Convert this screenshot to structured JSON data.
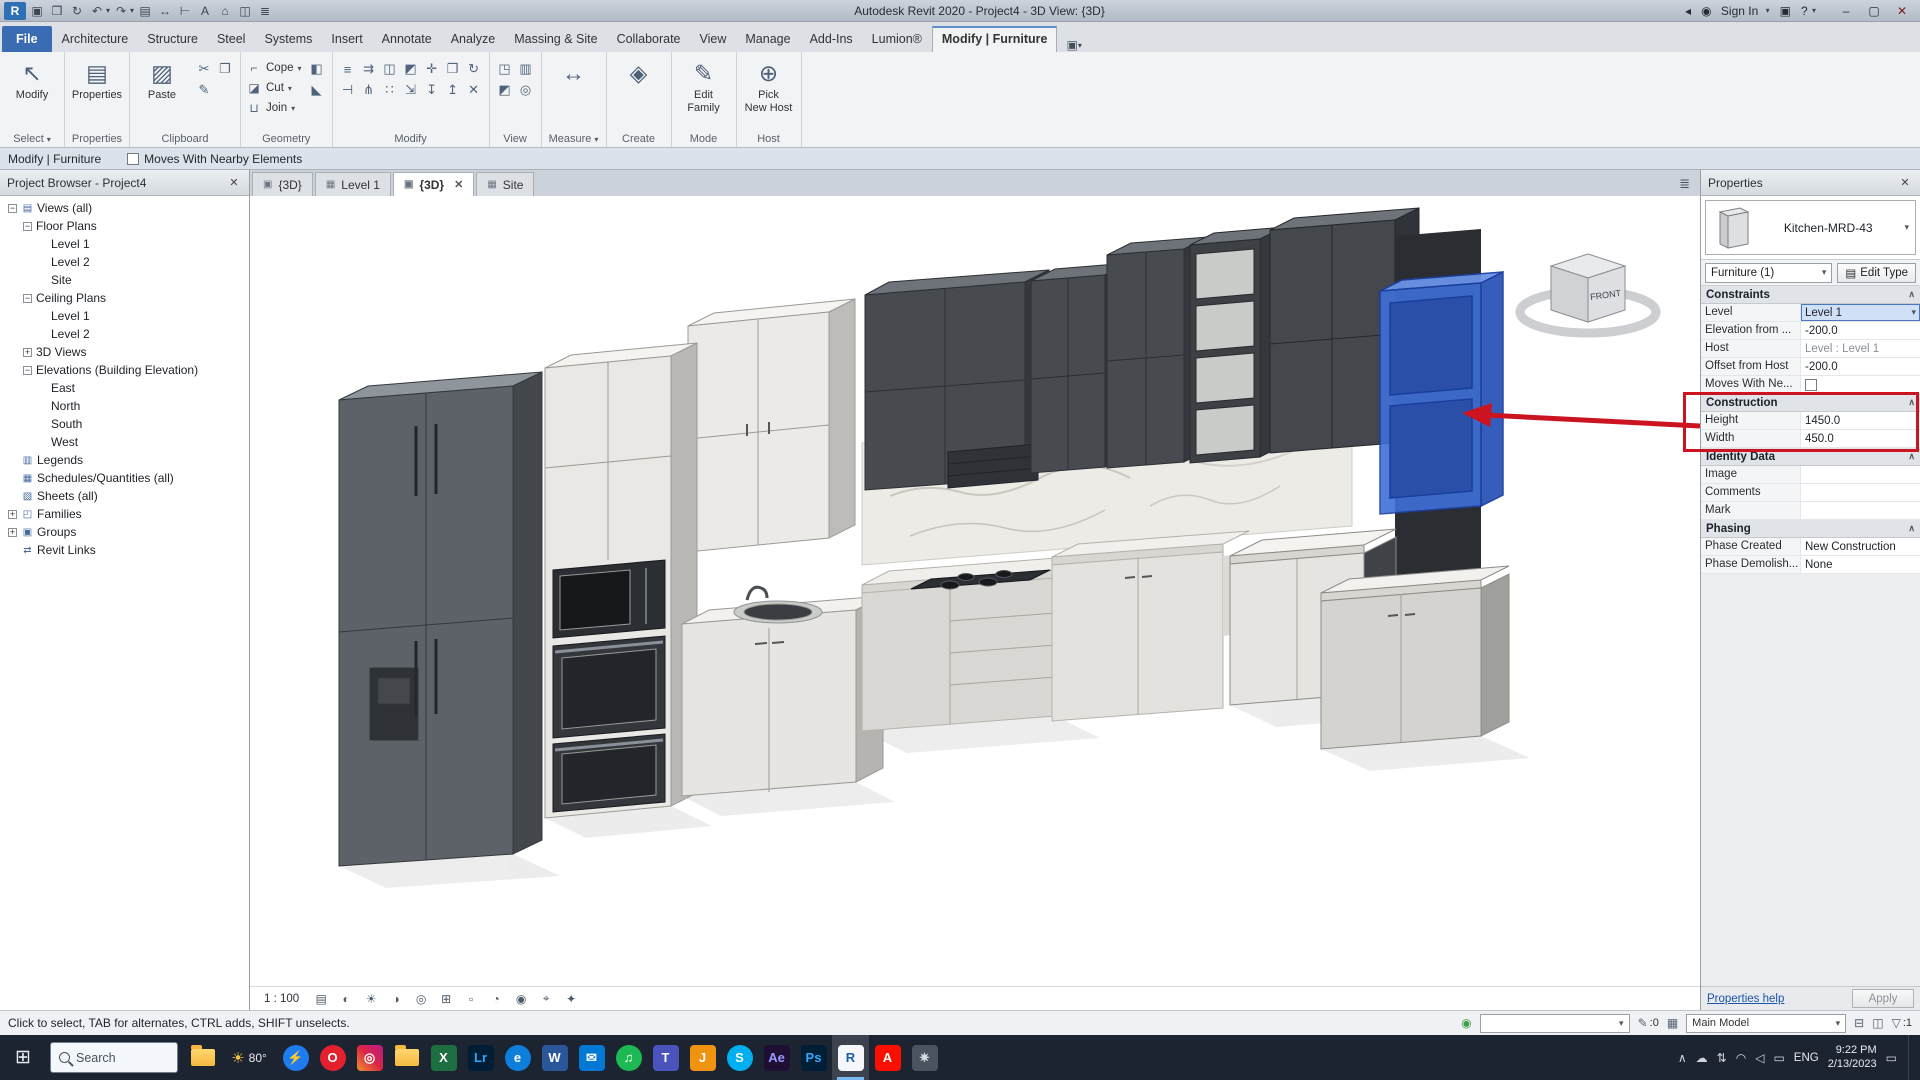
{
  "colors": {
    "accent_blue": "#2f6fb3",
    "selection_blue": "#3f6fd8",
    "annotation_red": "#cc1420",
    "taskbar_bg": "#1c2431"
  },
  "title_bar": {
    "app_title": "Autodesk Revit 2020 - Project4 - 3D View: {3D}",
    "sign_in_label": "Sign In",
    "qat_icons": [
      "app-menu",
      "save",
      "open",
      "sync",
      "undo",
      "redo",
      "print",
      "measure-qat",
      "dimension",
      "text",
      "default-3d",
      "section",
      "thin-lines"
    ],
    "right_icons": [
      "back",
      "user",
      "cart",
      "help"
    ],
    "window_controls": [
      "minimize",
      "maximize",
      "close"
    ]
  },
  "ribbon": {
    "tabs": [
      "File",
      "Architecture",
      "Structure",
      "Steel",
      "Systems",
      "Insert",
      "Annotate",
      "Analyze",
      "Massing & Site",
      "Collaborate",
      "View",
      "Manage",
      "Add-Ins",
      "Lumion®",
      "Modify | Furniture"
    ],
    "active_tab": "Modify | Furniture",
    "panels": [
      {
        "label": "Select",
        "caret": true,
        "big": [
          {
            "icon": "modify-arrow",
            "label": "Modify"
          }
        ]
      },
      {
        "label": "Properties",
        "big": [
          {
            "icon": "properties-big",
            "label": "Properties"
          }
        ]
      },
      {
        "label": "Clipboard",
        "big": [
          {
            "icon": "paste",
            "label": "Paste"
          }
        ],
        "small": [
          "cut-small",
          "copy-small",
          "match"
        ],
        "small_cols": 2
      },
      {
        "label": "Geometry",
        "rows": [
          {
            "icon": "cope",
            "label": "Cope",
            "caret": true
          },
          {
            "icon": "cut-geo",
            "label": "Cut",
            "caret": true
          },
          {
            "icon": "join",
            "label": "Join",
            "caret": true
          }
        ],
        "small": [
          "paint",
          "split-face"
        ],
        "small_cols": 1
      },
      {
        "label": "Modify",
        "small": [
          "align",
          "offset",
          "mirror-axis",
          "mirror-draw",
          "move",
          "copy",
          "rotate",
          "trim",
          "split",
          "array",
          "scale",
          "pin",
          "unpin",
          "delete"
        ],
        "small_cols": 7
      },
      {
        "label": "View",
        "small": [
          "wireframe",
          "hidden-line",
          "shaded",
          "render-view"
        ],
        "small_cols": 2
      },
      {
        "label": "Measure",
        "caret": true,
        "big": [
          {
            "icon": "measure-big",
            "label": ""
          }
        ]
      },
      {
        "label": "Create",
        "big": [
          {
            "icon": "create-big",
            "label": ""
          }
        ]
      },
      {
        "label": "Mode",
        "big": [
          {
            "icon": "edit-family",
            "label": "Edit\nFamily"
          }
        ]
      },
      {
        "label": "Host",
        "big": [
          {
            "icon": "pick-host",
            "label": "Pick\nNew Host"
          }
        ]
      }
    ]
  },
  "options_bar": {
    "mode_label": "Modify | Furniture",
    "checkbox_label": "Moves With Nearby Elements",
    "checkbox_checked": false
  },
  "project_browser": {
    "title": "Project Browser - Project4",
    "tree": [
      {
        "label": "Views (all)",
        "depth": 0,
        "expander": "-",
        "icon": "views"
      },
      {
        "label": "Floor Plans",
        "depth": 1,
        "expander": "-"
      },
      {
        "label": "Level 1",
        "depth": 2
      },
      {
        "label": "Level 2",
        "depth": 2
      },
      {
        "label": "Site",
        "depth": 2
      },
      {
        "label": "Ceiling Plans",
        "depth": 1,
        "expander": "-"
      },
      {
        "label": "Level 1",
        "depth": 2
      },
      {
        "label": "Level 2",
        "depth": 2
      },
      {
        "label": "3D Views",
        "depth": 1,
        "expander": "+"
      },
      {
        "label": "Elevations (Building Elevation)",
        "depth": 1,
        "expander": "-"
      },
      {
        "label": "East",
        "depth": 2
      },
      {
        "label": "North",
        "depth": 2
      },
      {
        "label": "South",
        "depth": 2
      },
      {
        "label": "West",
        "depth": 2
      },
      {
        "label": "Legends",
        "depth": 0,
        "icon": "legend"
      },
      {
        "label": "Schedules/Quantities (all)",
        "depth": 0,
        "icon": "schedule"
      },
      {
        "label": "Sheets (all)",
        "depth": 0,
        "icon": "sheet"
      },
      {
        "label": "Families",
        "depth": 0,
        "expander": "+",
        "icon": "family"
      },
      {
        "label": "Groups",
        "depth": 0,
        "expander": "+",
        "icon": "group"
      },
      {
        "label": "Revit Links",
        "depth": 0,
        "icon": "link"
      }
    ]
  },
  "view_tabs": [
    {
      "label": "{3D}",
      "icon": "tab-cube"
    },
    {
      "label": "Level 1",
      "icon": "tab-plan"
    },
    {
      "label": "{3D}",
      "icon": "tab-cube",
      "active": true,
      "closable": true
    },
    {
      "label": "Site",
      "icon": "tab-plan"
    }
  ],
  "canvas": {
    "viewcube_front_label": "FRONT"
  },
  "view_controls": {
    "scale": "1 : 100",
    "icons": [
      "detail-level",
      "visual-style",
      "sun",
      "shadows",
      "render-dialog",
      "crop",
      "show-crop",
      "hide-isolate",
      "reveal",
      "locked",
      "tvp"
    ]
  },
  "properties": {
    "header": "Properties",
    "type_name": "Kitchen-MRD-43",
    "category_selector": "Furniture (1)",
    "edit_type_label": "Edit Type",
    "rows": [
      {
        "kind": "section",
        "label": "Constraints"
      },
      {
        "kind": "row",
        "label": "Level",
        "value": "Level 1",
        "selected": true,
        "caret": true
      },
      {
        "kind": "row",
        "label": "Elevation from ...",
        "value": "-200.0"
      },
      {
        "kind": "row",
        "label": "Host",
        "value": "Level : Level 1",
        "disabled": true
      },
      {
        "kind": "row",
        "label": "Offset from Host",
        "value": "-200.0"
      },
      {
        "kind": "row",
        "label": "Moves With Ne...",
        "value": "",
        "checkbox": true
      },
      {
        "kind": "section",
        "label": "Construction"
      },
      {
        "kind": "row",
        "label": "Height",
        "value": "1450.0"
      },
      {
        "kind": "row",
        "label": "Width",
        "value": "450.0"
      },
      {
        "kind": "section",
        "label": "Identity Data"
      },
      {
        "kind": "row",
        "label": "Image",
        "value": ""
      },
      {
        "kind": "row",
        "label": "Comments",
        "value": ""
      },
      {
        "kind": "row",
        "label": "Mark",
        "value": ""
      },
      {
        "kind": "section",
        "label": "Phasing"
      },
      {
        "kind": "row",
        "label": "Phase Created",
        "value": "New Construction"
      },
      {
        "kind": "row",
        "label": "Phase Demolish...",
        "value": "None"
      }
    ],
    "help_link": "Properties help",
    "apply_label": "Apply"
  },
  "status_bar": {
    "hint": "Click to select, TAB for alternates, CTRL adds, SHIFT unselects.",
    "editable_count": ":0",
    "active_model": "Main Model",
    "selection_count": ":1"
  },
  "taskbar": {
    "search_label": "Search",
    "weather": "80°",
    "language": "ENG",
    "time": "9:22 PM",
    "date": "2/13/2023",
    "apps": [
      {
        "name": "file-explorer",
        "kind": "folder"
      },
      {
        "name": "weather",
        "kind": "weather"
      },
      {
        "name": "messenger",
        "text": "⚡",
        "fg": "#ffffff",
        "bg": "#1f7cf0",
        "round": true
      },
      {
        "name": "opera",
        "text": "O",
        "fg": "#ffffff",
        "bg": "#e5202e",
        "round": true
      },
      {
        "name": "instagram",
        "text": "◎",
        "fg": "#ffffff",
        "bg": "linear-gradient(45deg,#f09433,#dc2743,#bc1888)"
      },
      {
        "name": "downloads-folder",
        "kind": "folder"
      },
      {
        "name": "excel",
        "text": "X",
        "fg": "#ffffff",
        "bg": "#1d6f42"
      },
      {
        "name": "lightroom",
        "text": "Lr",
        "fg": "#31a8ff",
        "bg": "#001e36"
      },
      {
        "name": "edge",
        "text": "e",
        "fg": "#ffffff",
        "bg": "#0d7edb",
        "round": true
      },
      {
        "name": "word",
        "text": "W",
        "fg": "#ffffff",
        "bg": "#2b579a"
      },
      {
        "name": "mail",
        "text": "✉",
        "fg": "#ffffff",
        "bg": "#0078d4"
      },
      {
        "name": "spotify",
        "text": "♫",
        "fg": "#ffffff",
        "bg": "#1db954",
        "round": true
      },
      {
        "name": "teams",
        "text": "T",
        "fg": "#ffffff",
        "bg": "#4b53bc"
      },
      {
        "name": "java",
        "text": "J",
        "fg": "#ffffff",
        "bg": "#f0930f"
      },
      {
        "name": "skype",
        "text": "S",
        "fg": "#ffffff",
        "bg": "#00aff0",
        "round": true
      },
      {
        "name": "after-effects",
        "text": "Ae",
        "fg": "#9999ff",
        "bg": "#1f1033"
      },
      {
        "name": "photoshop",
        "text": "Ps",
        "fg": "#31a8ff",
        "bg": "#001e36"
      },
      {
        "name": "revit",
        "text": "R",
        "fg": "#1a5fae",
        "bg": "#f5f7fa",
        "active": true
      },
      {
        "name": "adobe",
        "text": "A",
        "fg": "#ffffff",
        "bg": "#fa0f00"
      },
      {
        "name": "settings",
        "text": "✷",
        "fg": "#d7dce2",
        "bg": "#4a5360"
      }
    ],
    "tray_icons": [
      "chevron",
      "cloud",
      "updown",
      "wifi",
      "volume",
      "battery"
    ]
  }
}
